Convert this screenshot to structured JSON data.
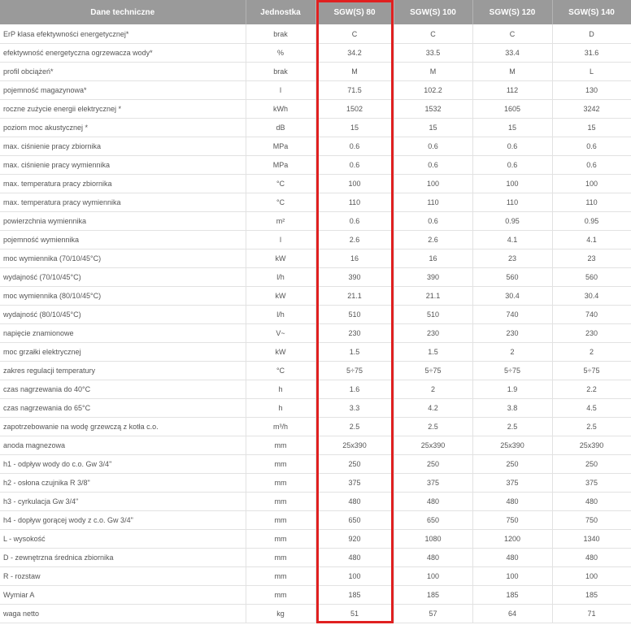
{
  "table": {
    "headers": [
      "Dane techniczne",
      "Jednostka",
      "SGW(S) 80",
      "SGW(S) 100",
      "SGW(S) 120",
      "SGW(S) 140"
    ],
    "rows": [
      [
        "ErP klasa efektywności energetycznej*",
        "brak",
        "C",
        "C",
        "C",
        "D"
      ],
      [
        "efektywność energetyczna ogrzewacza wody*",
        "%",
        "34.2",
        "33.5",
        "33.4",
        "31.6"
      ],
      [
        "profil obciążeń*",
        "brak",
        "M",
        "M",
        "M",
        "L"
      ],
      [
        "pojemność magazynowa*",
        "l",
        "71.5",
        "102.2",
        "112",
        "130"
      ],
      [
        "roczne zużycie energii elektrycznej *",
        "kWh",
        "1502",
        "1532",
        "1605",
        "3242"
      ],
      [
        "poziom moc akustycznej *",
        "dB",
        "15",
        "15",
        "15",
        "15"
      ],
      [
        "max. ciśnienie pracy zbiornika",
        "MPa",
        "0.6",
        "0.6",
        "0.6",
        "0.6"
      ],
      [
        "max. ciśnienie pracy wymiennika",
        "MPa",
        "0.6",
        "0.6",
        "0.6",
        "0.6"
      ],
      [
        "max. temperatura pracy zbiornika",
        "°C",
        "100",
        "100",
        "100",
        "100"
      ],
      [
        "max. temperatura pracy wymiennika",
        "°C",
        "110",
        "110",
        "110",
        "110"
      ],
      [
        "powierzchnia wymiennika",
        "m²",
        "0.6",
        "0.6",
        "0.95",
        "0.95"
      ],
      [
        "pojemność wymiennika",
        "l",
        "2.6",
        "2.6",
        "4.1",
        "4.1"
      ],
      [
        "moc wymiennika (70/10/45°C)",
        "kW",
        "16",
        "16",
        "23",
        "23"
      ],
      [
        "wydajność (70/10/45°C)",
        "l/h",
        "390",
        "390",
        "560",
        "560"
      ],
      [
        "moc wymiennika (80/10/45°C)",
        "kW",
        "21.1",
        "21.1",
        "30.4",
        "30.4"
      ],
      [
        "wydajność (80/10/45°C)",
        "l/h",
        "510",
        "510",
        "740",
        "740"
      ],
      [
        "napięcie znamionowe",
        "V~",
        "230",
        "230",
        "230",
        "230"
      ],
      [
        "moc grzałki elektrycznej",
        "kW",
        "1.5",
        "1.5",
        "2",
        "2"
      ],
      [
        "zakres regulacji temperatury",
        "°C",
        "5÷75",
        "5÷75",
        "5÷75",
        "5÷75"
      ],
      [
        "czas nagrzewania do 40°C",
        "h",
        "1.6",
        "2",
        "1.9",
        "2.2"
      ],
      [
        "czas nagrzewania do 65°C",
        "h",
        "3.3",
        "4.2",
        "3.8",
        "4.5"
      ],
      [
        "zapotrzebowanie na wodę grzewczą z kotła c.o.",
        "m³/h",
        "2.5",
        "2.5",
        "2.5",
        "2.5"
      ],
      [
        "anoda magnezowa",
        "mm",
        "25x390",
        "25x390",
        "25x390",
        "25x390"
      ],
      [
        "h1 - odpływ wody do c.o. Gw 3/4\"",
        "mm",
        "250",
        "250",
        "250",
        "250"
      ],
      [
        "h2 - osłona czujnika R 3/8\"",
        "mm",
        "375",
        "375",
        "375",
        "375"
      ],
      [
        "h3 - cyrkulacja Gw 3/4\"",
        "mm",
        "480",
        "480",
        "480",
        "480"
      ],
      [
        "h4 - dopływ gorącej wody z c.o. Gw 3/4\"",
        "mm",
        "650",
        "650",
        "750",
        "750"
      ],
      [
        "L - wysokość",
        "mm",
        "920",
        "1080",
        "1200",
        "1340"
      ],
      [
        "D - zewnętrzna średnica zbiornika",
        "mm",
        "480",
        "480",
        "480",
        "480"
      ],
      [
        "R - rozstaw",
        "mm",
        "100",
        "100",
        "100",
        "100"
      ],
      [
        "Wymiar A",
        "mm",
        "185",
        "185",
        "185",
        "185"
      ],
      [
        "waga netto",
        "kg",
        "51",
        "57",
        "64",
        "71"
      ]
    ]
  },
  "highlight": {
    "column": "SGW(S) 80",
    "color": "#e02020"
  },
  "colors": {
    "header_bg": "#9a9a9a",
    "header_text": "#ffffff",
    "cell_text": "#555555",
    "grid": "#e2e2e2"
  }
}
